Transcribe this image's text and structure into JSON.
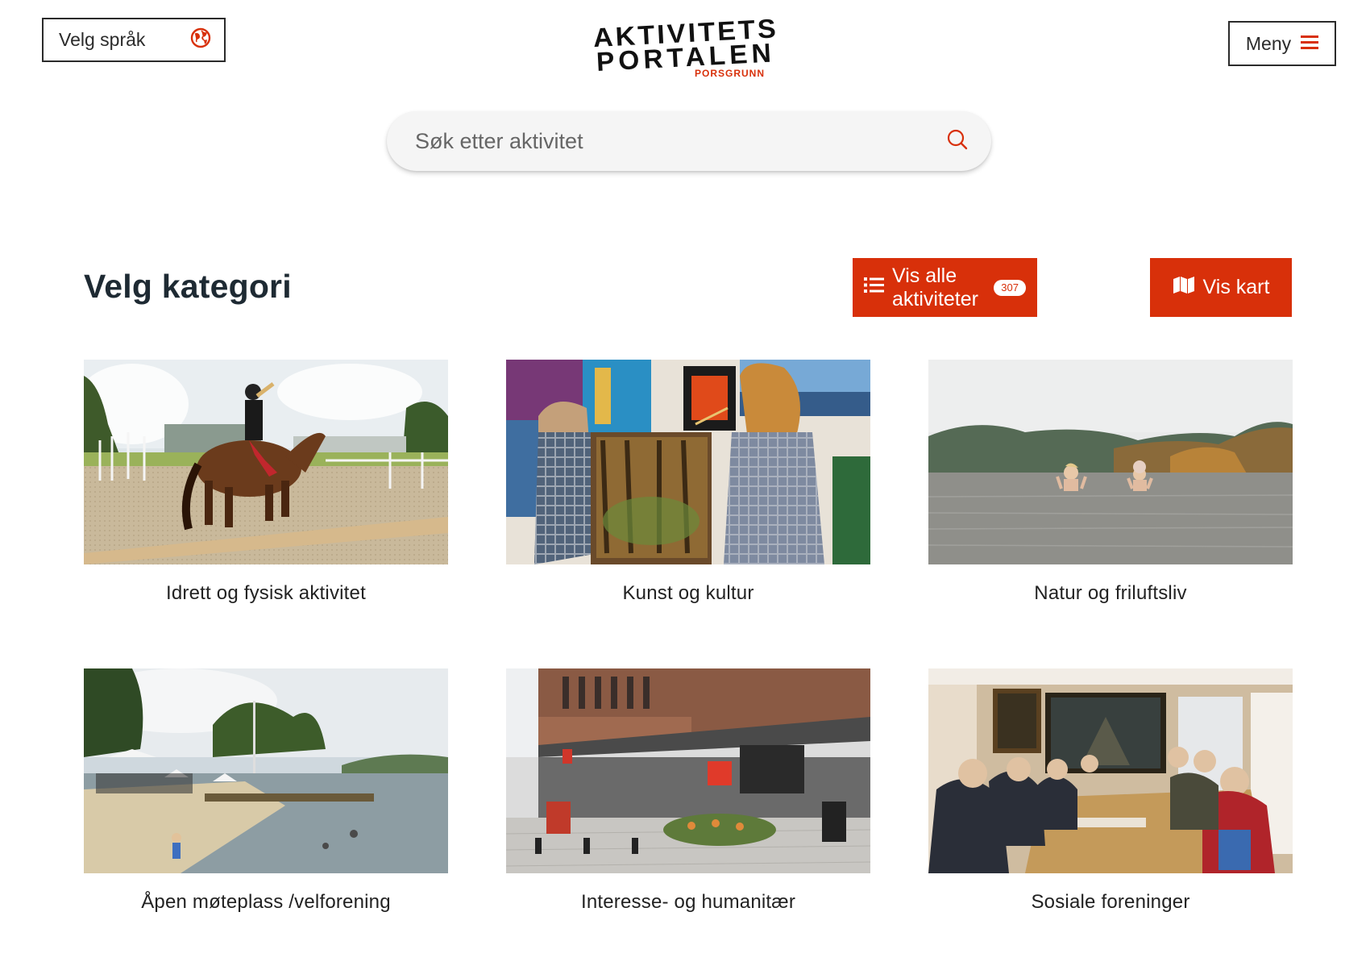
{
  "header": {
    "language_label": "Velg språk",
    "language_icon": "globe-icon",
    "logo_line1": "AKTIVITETS",
    "logo_line2": "PORTALEN",
    "logo_subline": "PORSGRUNN",
    "menu_label": "Meny",
    "menu_icon": "hamburger-icon"
  },
  "search": {
    "placeholder": "Søk etter aktivitet",
    "value": "",
    "icon": "search-icon"
  },
  "main": {
    "heading": "Velg kategori",
    "show_all_label": "Vis alle aktiviteter",
    "show_all_count": "307",
    "show_all_icon": "list-icon",
    "show_map_label": "Vis kart",
    "show_map_icon": "map-icon"
  },
  "categories": [
    {
      "label": "Idrett og fysisk aktivitet"
    },
    {
      "label": "Kunst og kultur"
    },
    {
      "label": "Natur og friluftsliv"
    },
    {
      "label": "Åpen møteplass /velforening"
    },
    {
      "label": "Interesse- og humanitær"
    },
    {
      "label": "Sosiale foreninger"
    }
  ],
  "colors": {
    "accent": "#d8300a",
    "text_dark": "#1e2a33",
    "search_bg": "#f5f5f5"
  }
}
